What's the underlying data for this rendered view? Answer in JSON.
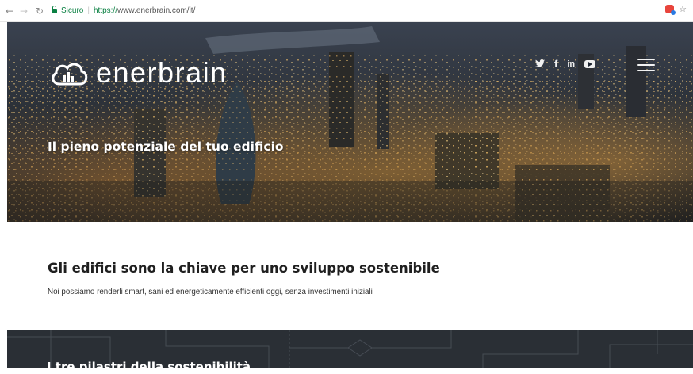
{
  "browser": {
    "secure_label": "Sicuro",
    "url_scheme": "https://",
    "url_rest": "www.enerbrain.com/it/"
  },
  "header": {
    "logo_text": "enerbrain",
    "social": [
      "twitter-icon",
      "facebook-icon",
      "linkedin-icon",
      "youtube-icon"
    ],
    "menu_icon": "hamburger-menu-icon"
  },
  "hero": {
    "tagline": "Il pieno potenziale del tuo edificio"
  },
  "intro": {
    "title": "Gli edifici sono la chiave per uno sviluppo sostenibile",
    "subtitle": "Noi possiamo renderli smart, sani ed energeticamente efficienti oggi, senza investimenti iniziali"
  },
  "pillars": {
    "title": "I tre pilastri della sostenibilità"
  }
}
